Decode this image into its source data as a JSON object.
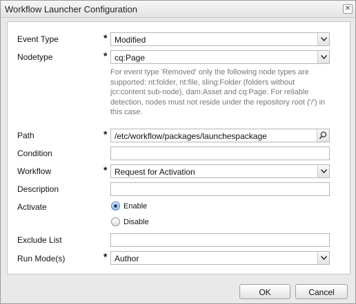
{
  "dialog": {
    "title": "Workflow Launcher Configuration",
    "close_glyph": "✕"
  },
  "form": {
    "event_type": {
      "label": "Event Type",
      "required_mark": "*",
      "value": "Modified"
    },
    "nodetype": {
      "label": "Nodetype",
      "required_mark": "*",
      "value": "cq:Page"
    },
    "nodetype_help": [
      "For event type 'Removed' only the following node types are",
      "supported: nt:folder, nt:file, sling:Folder (folders without",
      "jcr:content sub-node), dam:Asset and cq:Page. For reliable",
      "detection, nodes must not reside under the repository root ('/') in",
      "this case."
    ],
    "path": {
      "label": "Path",
      "required_mark": "*",
      "value": "/etc/workflow/packages/launchespackage"
    },
    "condition": {
      "label": "Condition",
      "value": ""
    },
    "workflow": {
      "label": "Workflow",
      "required_mark": "*",
      "value": "Request for Activation"
    },
    "description": {
      "label": "Description",
      "value": ""
    },
    "activate": {
      "label": "Activate",
      "options": [
        "Enable",
        "Disable"
      ],
      "selected": "Enable"
    },
    "exclude_list": {
      "label": "Exclude List",
      "value": ""
    },
    "run_modes": {
      "label": "Run Mode(s)",
      "required_mark": "*",
      "value": "Author"
    }
  },
  "buttons": {
    "ok": "OK",
    "cancel": "Cancel"
  },
  "icons": {
    "dropdown": "chevron-down-icon",
    "path_picker": "search-icon",
    "close": "close-icon"
  }
}
